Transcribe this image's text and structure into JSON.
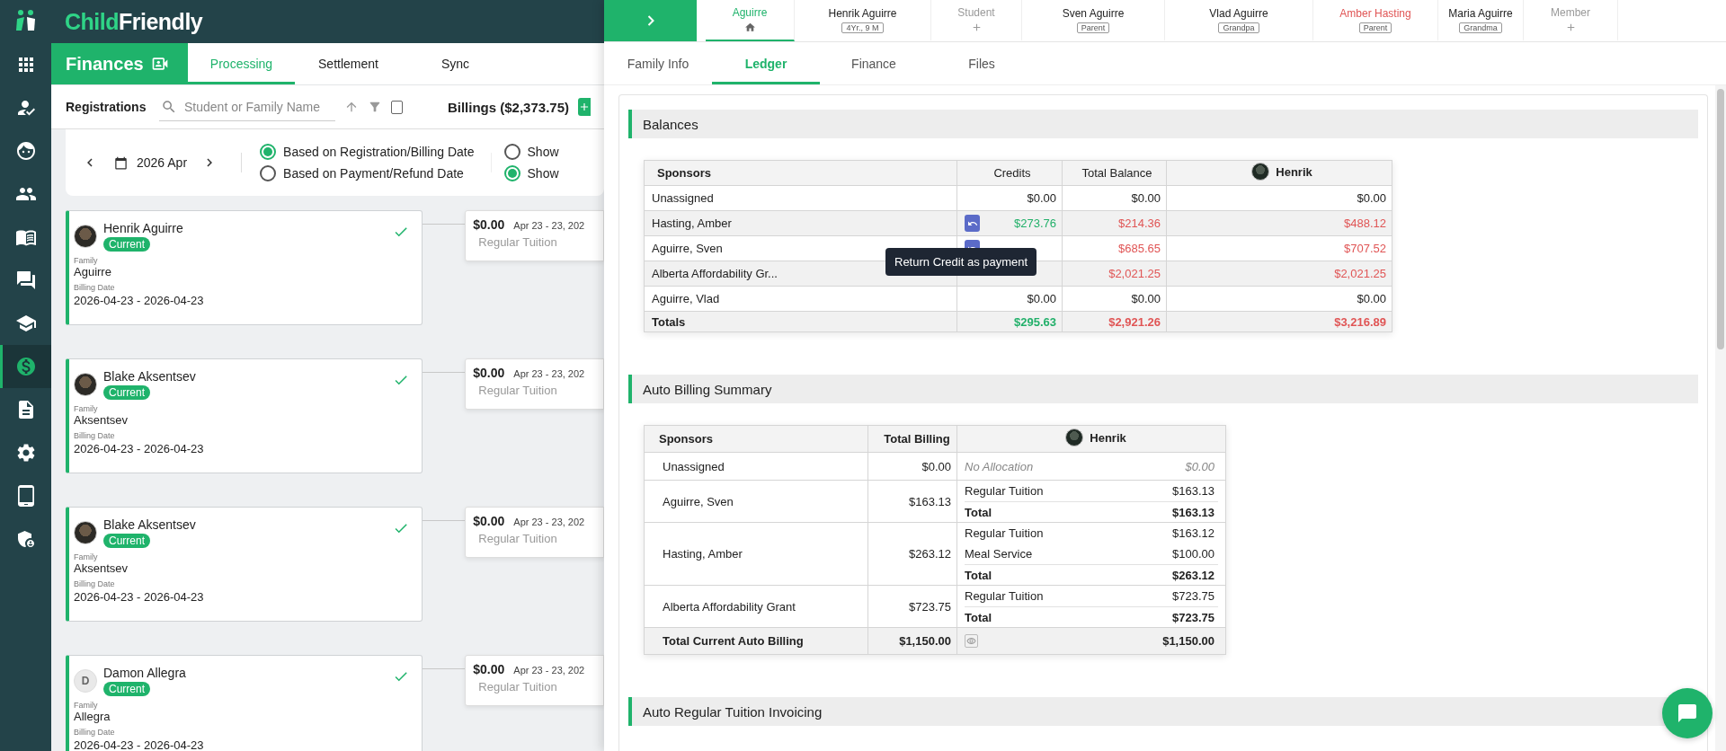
{
  "logo": {
    "first": "Child",
    "second": "Friendly"
  },
  "nav": [
    {
      "kind": "apps",
      "selected": false
    },
    {
      "kind": "person-check",
      "selected": false
    },
    {
      "kind": "face",
      "selected": false
    },
    {
      "kind": "people",
      "selected": false
    },
    {
      "kind": "book",
      "selected": false
    },
    {
      "kind": "chat",
      "selected": false
    },
    {
      "kind": "school",
      "selected": false
    },
    {
      "kind": "money",
      "selected": true
    },
    {
      "kind": "document",
      "selected": false
    },
    {
      "kind": "settings",
      "selected": false
    },
    {
      "kind": "tablet",
      "selected": false
    },
    {
      "kind": "shield",
      "selected": false
    }
  ],
  "finances": {
    "title": "Finances",
    "tabs": [
      {
        "label": "Processing",
        "selected": true
      },
      {
        "label": "Settlement",
        "selected": false
      },
      {
        "label": "Sync",
        "selected": false
      }
    ]
  },
  "registrations_bar": {
    "title": "Registrations",
    "search_placeholder": "Student or Family Name",
    "select_all_checked": false,
    "billings": "Billings ($2,373.75)"
  },
  "filter": {
    "month": "2026 Apr",
    "date_basis": [
      {
        "label": "Based on Registration/Billing Date",
        "selected": true
      },
      {
        "label": "Based on Payment/Refund Date",
        "selected": false
      }
    ],
    "show_options": [
      {
        "label": "Show",
        "selected": false
      },
      {
        "label": "Show",
        "selected": true
      }
    ]
  },
  "registrations": [
    {
      "name": "Henrik Aguirre",
      "avatar": {
        "kind": "photo"
      },
      "status": "Current",
      "family_label": "Family",
      "family": "Aguirre",
      "billing_label": "Billing Date",
      "billing_date": "2026-04-23 - 2026-04-23",
      "checked": true,
      "billing": {
        "amount": "$0.00",
        "dates": "Apr 23 - 23, 202",
        "item": "Regular Tuition"
      }
    },
    {
      "name": "Blake Aksentsev",
      "avatar": {
        "kind": "photo"
      },
      "status": "Current",
      "family_label": "Family",
      "family": "Aksentsev",
      "billing_label": "Billing Date",
      "billing_date": "2026-04-23 - 2026-04-23",
      "checked": true,
      "billing": {
        "amount": "$0.00",
        "dates": "Apr 23 - 23, 202",
        "item": "Regular Tuition"
      }
    },
    {
      "name": "Blake Aksentsev",
      "avatar": {
        "kind": "photo"
      },
      "status": "Current",
      "family_label": "Family",
      "family": "Aksentsev",
      "billing_label": "Billing Date",
      "billing_date": "2026-04-23 - 2026-04-23",
      "checked": true,
      "billing": {
        "amount": "$0.00",
        "dates": "Apr 23 - 23, 202",
        "item": "Regular Tuition"
      }
    },
    {
      "name": "Damon Allegra",
      "avatar": {
        "kind": "initial",
        "initial": "D"
      },
      "status": "Current",
      "family_label": "Family",
      "family": "Allegra",
      "billing_label": "Billing Date",
      "billing_date": "2026-04-23 - 2026-04-23",
      "checked": true,
      "billing": {
        "amount": "$0.00",
        "dates": "Apr 23 - 23, 202",
        "item": "Regular Tuition"
      }
    }
  ],
  "members": [
    {
      "kind": "family",
      "name": "Aguirre",
      "selected": true
    },
    {
      "kind": "person",
      "name": "Henrik Aguirre",
      "tag": "4Yr., 9 M",
      "flagged": false,
      "selected": false
    },
    {
      "kind": "add",
      "name": "Student",
      "selected": false
    },
    {
      "kind": "person",
      "name": "Sven Aguirre",
      "tag": "Parent",
      "flagged": false,
      "selected": false
    },
    {
      "kind": "person",
      "name": "Vlad Aguirre",
      "tag": "Grandpa",
      "flagged": false,
      "selected": false
    },
    {
      "kind": "person",
      "name": "Amber Hasting",
      "tag": "Parent",
      "flagged": true,
      "selected": false
    },
    {
      "kind": "person",
      "name": "Maria Aguirre",
      "tag": "Grandma",
      "flagged": false,
      "selected": false
    },
    {
      "kind": "add",
      "name": "Member",
      "selected": false
    }
  ],
  "family_tabs": [
    {
      "label": "Family Info",
      "selected": false
    },
    {
      "label": "Ledger",
      "selected": true
    },
    {
      "label": "Finance",
      "selected": false
    },
    {
      "label": "Files",
      "selected": false
    }
  ],
  "balances": {
    "title": "Balances",
    "columns": [
      "Sponsors",
      "Credits",
      "Total Balance",
      "Henrik"
    ],
    "rows": [
      {
        "sponsor": "Unassigned",
        "return_button": false,
        "credits": {
          "text": "$0.00",
          "kind": "plain"
        },
        "total_balance": {
          "text": "$0.00",
          "kind": "plain"
        },
        "henrik": {
          "text": "$0.00",
          "kind": "plain"
        }
      },
      {
        "sponsor": "Hasting, Amber",
        "return_button": true,
        "credits": {
          "text": "$273.76",
          "kind": "positive"
        },
        "total_balance": {
          "text": "$214.36",
          "kind": "negative"
        },
        "henrik": {
          "text": "$488.12",
          "kind": "negative"
        }
      },
      {
        "sponsor": "Aguirre, Sven",
        "return_button": true,
        "total_balance": {
          "text": "$685.65",
          "kind": "negative"
        },
        "henrik": {
          "text": "$707.52",
          "kind": "negative"
        }
      },
      {
        "sponsor": "Alberta Affordability Gr...",
        "return_button": false,
        "total_balance": {
          "text": "$2,021.25",
          "kind": "negative"
        },
        "henrik": {
          "text": "$2,021.25",
          "kind": "negative"
        }
      },
      {
        "sponsor": "Aguirre, Vlad",
        "return_button": false,
        "credits": {
          "text": "$0.00",
          "kind": "plain"
        },
        "total_balance": {
          "text": "$0.00",
          "kind": "plain"
        },
        "henrik": {
          "text": "$0.00",
          "kind": "plain"
        }
      }
    ],
    "totals": {
      "label": "Totals",
      "credits": {
        "text": "$295.63",
        "kind": "positive"
      },
      "total_balance": {
        "text": "$2,921.26",
        "kind": "negative"
      },
      "henrik": {
        "text": "$3,216.89",
        "kind": "negative"
      }
    },
    "tooltip": "Return Credit as payment"
  },
  "auto_billing": {
    "title": "Auto Billing Summary",
    "columns": [
      "Sponsors",
      "Total Billing",
      "Henrik"
    ],
    "rows": [
      {
        "sponsor": "Unassigned",
        "total": "$0.00",
        "lines": [
          {
            "kind": "none",
            "label": "No Allocation",
            "amount": "$0.00"
          }
        ]
      },
      {
        "sponsor": "Aguirre, Sven",
        "total": "$163.13",
        "lines": [
          {
            "kind": "item",
            "label": "Regular Tuition",
            "amount": "$163.13"
          },
          {
            "kind": "total",
            "label": "Total",
            "amount": "$163.13"
          }
        ]
      },
      {
        "sponsor": "Hasting, Amber",
        "total": "$263.12",
        "lines": [
          {
            "kind": "item",
            "label": "Regular Tuition",
            "amount": "$163.12"
          },
          {
            "kind": "item",
            "label": "Meal Service",
            "amount": "$100.00"
          },
          {
            "kind": "total",
            "label": "Total",
            "amount": "$263.12"
          }
        ]
      },
      {
        "sponsor": "Alberta Affordability Grant",
        "total": "$723.75",
        "lines": [
          {
            "kind": "item",
            "label": "Regular Tuition",
            "amount": "$723.75"
          },
          {
            "kind": "total",
            "label": "Total",
            "amount": "$723.75"
          }
        ]
      }
    ],
    "footer": {
      "label": "Total Current Auto Billing",
      "total": "$1,150.00",
      "amount": "$1,150.00"
    }
  },
  "invoicing": {
    "title": "Auto Regular Tuition Invoicing"
  }
}
